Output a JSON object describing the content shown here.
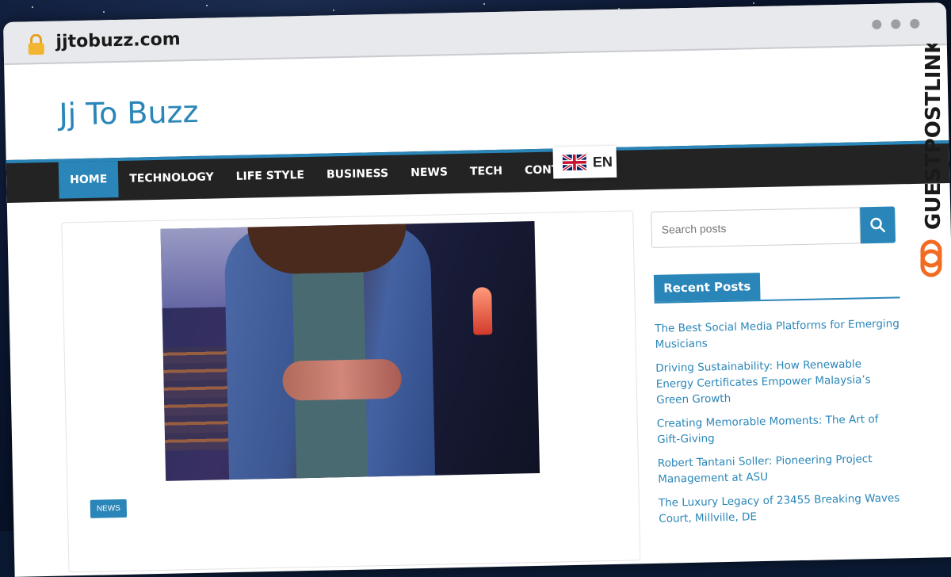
{
  "browser": {
    "url": "jjtobuzz.com"
  },
  "site": {
    "title": "Jj To Buzz"
  },
  "nav": {
    "items": [
      {
        "label": "HOME",
        "active": true
      },
      {
        "label": "TECHNOLOGY",
        "active": false
      },
      {
        "label": "LIFE STYLE",
        "active": false
      },
      {
        "label": "BUSINESS",
        "active": false
      },
      {
        "label": "NEWS",
        "active": false
      },
      {
        "label": "TECH",
        "active": false
      },
      {
        "label": "CONTACT US",
        "active": false
      }
    ],
    "language": {
      "code": "EN",
      "flag_icon": "uk-flag-icon"
    }
  },
  "post": {
    "category": "NEWS"
  },
  "search": {
    "placeholder": "Search posts",
    "icon": "search-icon"
  },
  "sidebar": {
    "recent_posts_title": "Recent Posts",
    "recent_posts": [
      "The Best Social Media Platforms for Emerging Musicians",
      "Driving Sustainability: How Renewable Energy Certificates Empower Malaysia’s Green Growth",
      "Creating Memorable Moments: The Art of Gift-Giving",
      "Robert Tantani Soller: Pioneering Project Management at ASU",
      "The Luxury Legacy of 23455 Breaking Waves Court, Millville, DE"
    ]
  },
  "watermark": {
    "text": "GUESTPOSTLINKS"
  },
  "colors": {
    "accent": "#2a86b8",
    "navbar": "#232323",
    "watermark_orange": "#f26b21"
  }
}
